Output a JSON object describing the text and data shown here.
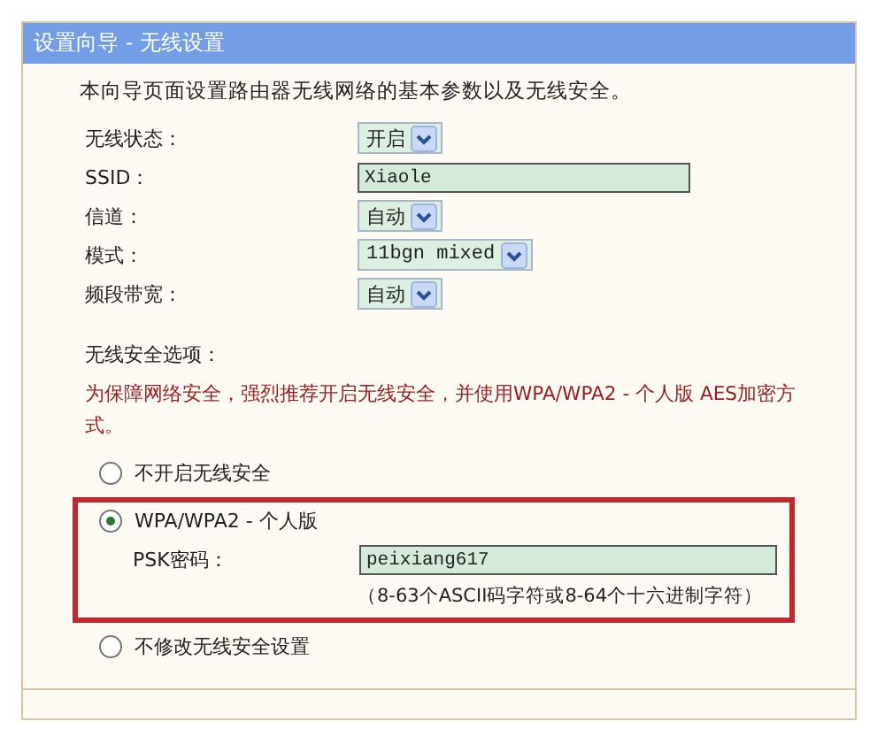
{
  "panel": {
    "title": "设置向导 - 无线设置",
    "intro": "本向导页面设置路由器无线网络的基本参数以及无线安全。"
  },
  "fields": [
    {
      "label": "无线状态：",
      "kind": "select",
      "value": "开启"
    },
    {
      "label": "SSID：",
      "kind": "text",
      "value": "Xiaole"
    },
    {
      "label": "信道：",
      "kind": "select",
      "value": "自动"
    },
    {
      "label": "模式：",
      "kind": "select",
      "value": "11bgn mixed"
    },
    {
      "label": "频段带宽：",
      "kind": "select",
      "value": "自动"
    }
  ],
  "security": {
    "title": "无线安全选项：",
    "warning": "为保障网络安全，强烈推荐开启无线安全，并使用WPA/WPA2 - 个人版 AES加密方式。",
    "options": [
      {
        "label": "不开启无线安全",
        "selected": false,
        "highlighted": false
      },
      {
        "label": "WPA/WPA2 - 个人版",
        "selected": true,
        "highlighted": true,
        "psk": {
          "label": "PSK密码：",
          "value": "peixiang617",
          "hint": "（8-63个ASCII码字符或8-64个十六进制字符）"
        }
      },
      {
        "label": "不修改无线安全设置",
        "selected": false,
        "highlighted": false
      }
    ]
  }
}
